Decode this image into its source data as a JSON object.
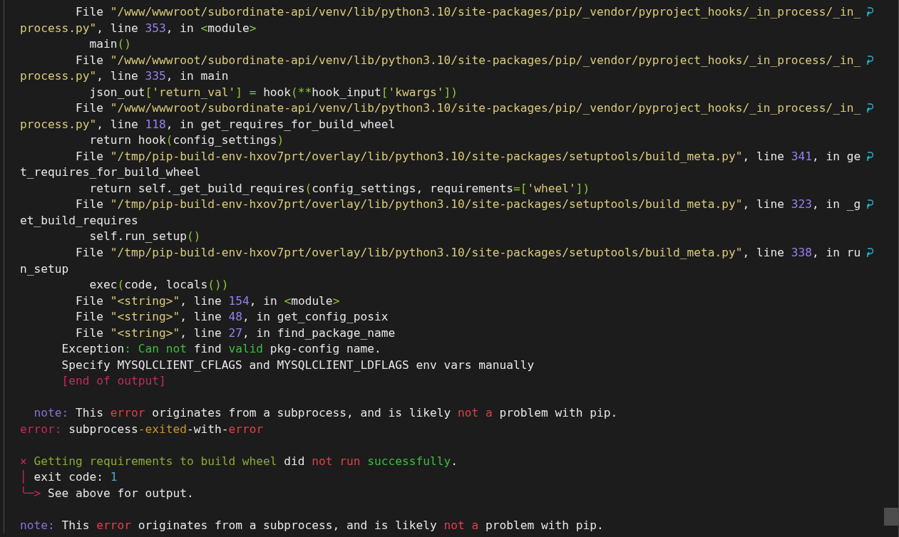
{
  "terminal": {
    "lines": [
      {
        "wrapped": true,
        "segments": [
          {
            "text": "        File ",
            "color": "#e6e6e6"
          },
          {
            "text": "\"/www/wwwroot/subordinate-api/venv/lib/python3.10/site-packages/pip/_vendor/pyproject_hooks/_in_process/_in_",
            "color": "#d9cb78"
          }
        ]
      },
      {
        "wrapped": false,
        "segments": [
          {
            "text": "process.py\"",
            "color": "#d9cb78"
          },
          {
            "text": ", line ",
            "color": "#e6e6e6"
          },
          {
            "text": "353",
            "color": "#9b7ff0"
          },
          {
            "text": ", in ",
            "color": "#e6e6e6"
          },
          {
            "text": "<",
            "color": "#8cc83c"
          },
          {
            "text": "module",
            "color": "#e6e6e6"
          },
          {
            "text": ">",
            "color": "#8cc83c"
          }
        ]
      },
      {
        "wrapped": false,
        "segments": [
          {
            "text": "          main",
            "color": "#e6e6e6"
          },
          {
            "text": "()",
            "color": "#8cc83c"
          }
        ]
      },
      {
        "wrapped": true,
        "segments": [
          {
            "text": "        File ",
            "color": "#e6e6e6"
          },
          {
            "text": "\"/www/wwwroot/subordinate-api/venv/lib/python3.10/site-packages/pip/_vendor/pyproject_hooks/_in_process/_in_",
            "color": "#d9cb78"
          }
        ]
      },
      {
        "wrapped": false,
        "segments": [
          {
            "text": "process.py\"",
            "color": "#d9cb78"
          },
          {
            "text": ", line ",
            "color": "#e6e6e6"
          },
          {
            "text": "335",
            "color": "#9b7ff0"
          },
          {
            "text": ", in main",
            "color": "#e6e6e6"
          }
        ]
      },
      {
        "wrapped": false,
        "segments": [
          {
            "text": "          json_out",
            "color": "#e6e6e6"
          },
          {
            "text": "[",
            "color": "#8cc83c"
          },
          {
            "text": "'return_val'",
            "color": "#d9cb78"
          },
          {
            "text": "] = ",
            "color": "#8cc83c"
          },
          {
            "text": "hook",
            "color": "#e6e6e6"
          },
          {
            "text": "(**",
            "color": "#8cc83c"
          },
          {
            "text": "hook_input",
            "color": "#e6e6e6"
          },
          {
            "text": "[",
            "color": "#8cc83c"
          },
          {
            "text": "'kwargs'",
            "color": "#d9cb78"
          },
          {
            "text": "])",
            "color": "#8cc83c"
          }
        ]
      },
      {
        "wrapped": true,
        "segments": [
          {
            "text": "        File ",
            "color": "#e6e6e6"
          },
          {
            "text": "\"/www/wwwroot/subordinate-api/venv/lib/python3.10/site-packages/pip/_vendor/pyproject_hooks/_in_process/_in_",
            "color": "#d9cb78"
          }
        ]
      },
      {
        "wrapped": false,
        "segments": [
          {
            "text": "process.py\"",
            "color": "#d9cb78"
          },
          {
            "text": ", line ",
            "color": "#e6e6e6"
          },
          {
            "text": "118",
            "color": "#9b7ff0"
          },
          {
            "text": ", in get_requires_for_build_wheel",
            "color": "#e6e6e6"
          }
        ]
      },
      {
        "wrapped": false,
        "segments": [
          {
            "text": "          return hook",
            "color": "#e6e6e6"
          },
          {
            "text": "(",
            "color": "#8cc83c"
          },
          {
            "text": "config_settings",
            "color": "#e6e6e6"
          },
          {
            "text": ")",
            "color": "#8cc83c"
          }
        ]
      },
      {
        "wrapped": true,
        "segments": [
          {
            "text": "        File ",
            "color": "#e6e6e6"
          },
          {
            "text": "\"/tmp/pip-build-env-hxov7prt/overlay/lib/python3.10/site-packages/setuptools/build_meta.py\"",
            "color": "#d9cb78"
          },
          {
            "text": ", line ",
            "color": "#e6e6e6"
          },
          {
            "text": "341",
            "color": "#9b7ff0"
          },
          {
            "text": ", in ge",
            "color": "#e6e6e6"
          }
        ]
      },
      {
        "wrapped": false,
        "segments": [
          {
            "text": "t_requires_for_build_wheel",
            "color": "#e6e6e6"
          }
        ]
      },
      {
        "wrapped": false,
        "segments": [
          {
            "text": "          return self._get_build_requires",
            "color": "#e6e6e6"
          },
          {
            "text": "(",
            "color": "#8cc83c"
          },
          {
            "text": "config_settings, requirements",
            "color": "#e6e6e6"
          },
          {
            "text": "=[",
            "color": "#8cc83c"
          },
          {
            "text": "'wheel'",
            "color": "#d9cb78"
          },
          {
            "text": "])",
            "color": "#8cc83c"
          }
        ]
      },
      {
        "wrapped": true,
        "segments": [
          {
            "text": "        File ",
            "color": "#e6e6e6"
          },
          {
            "text": "\"/tmp/pip-build-env-hxov7prt/overlay/lib/python3.10/site-packages/setuptools/build_meta.py\"",
            "color": "#d9cb78"
          },
          {
            "text": ", line ",
            "color": "#e6e6e6"
          },
          {
            "text": "323",
            "color": "#9b7ff0"
          },
          {
            "text": ", in _g",
            "color": "#e6e6e6"
          }
        ]
      },
      {
        "wrapped": false,
        "segments": [
          {
            "text": "et_build_requires",
            "color": "#e6e6e6"
          }
        ]
      },
      {
        "wrapped": false,
        "segments": [
          {
            "text": "          self.run_setup",
            "color": "#e6e6e6"
          },
          {
            "text": "()",
            "color": "#8cc83c"
          }
        ]
      },
      {
        "wrapped": true,
        "segments": [
          {
            "text": "        File ",
            "color": "#e6e6e6"
          },
          {
            "text": "\"/tmp/pip-build-env-hxov7prt/overlay/lib/python3.10/site-packages/setuptools/build_meta.py\"",
            "color": "#d9cb78"
          },
          {
            "text": ", line ",
            "color": "#e6e6e6"
          },
          {
            "text": "338",
            "color": "#9b7ff0"
          },
          {
            "text": ", in ru",
            "color": "#e6e6e6"
          }
        ]
      },
      {
        "wrapped": false,
        "segments": [
          {
            "text": "n_setup",
            "color": "#e6e6e6"
          }
        ]
      },
      {
        "wrapped": false,
        "segments": [
          {
            "text": "          exec",
            "color": "#e6e6e6"
          },
          {
            "text": "(",
            "color": "#8cc83c"
          },
          {
            "text": "code, locals",
            "color": "#e6e6e6"
          },
          {
            "text": "())",
            "color": "#8cc83c"
          }
        ]
      },
      {
        "wrapped": false,
        "segments": [
          {
            "text": "        File ",
            "color": "#e6e6e6"
          },
          {
            "text": "\"<string>\"",
            "color": "#d9cb78"
          },
          {
            "text": ", line ",
            "color": "#e6e6e6"
          },
          {
            "text": "154",
            "color": "#9b7ff0"
          },
          {
            "text": ", in ",
            "color": "#e6e6e6"
          },
          {
            "text": "<",
            "color": "#8cc83c"
          },
          {
            "text": "module",
            "color": "#e6e6e6"
          },
          {
            "text": ">",
            "color": "#8cc83c"
          }
        ]
      },
      {
        "wrapped": false,
        "segments": [
          {
            "text": "        File ",
            "color": "#e6e6e6"
          },
          {
            "text": "\"<string>\"",
            "color": "#d9cb78"
          },
          {
            "text": ", line ",
            "color": "#e6e6e6"
          },
          {
            "text": "48",
            "color": "#9b7ff0"
          },
          {
            "text": ", in get_config_posix",
            "color": "#e6e6e6"
          }
        ]
      },
      {
        "wrapped": false,
        "segments": [
          {
            "text": "        File ",
            "color": "#e6e6e6"
          },
          {
            "text": "\"<string>\"",
            "color": "#d9cb78"
          },
          {
            "text": ", line ",
            "color": "#e6e6e6"
          },
          {
            "text": "27",
            "color": "#9b7ff0"
          },
          {
            "text": ", in find_package_name",
            "color": "#e6e6e6"
          }
        ]
      },
      {
        "wrapped": false,
        "segments": [
          {
            "text": "      Exception",
            "color": "#e6e6e6"
          },
          {
            "text": ": Can not",
            "color": "#3cbe3c"
          },
          {
            "text": " find ",
            "color": "#e6e6e6"
          },
          {
            "text": "valid",
            "color": "#3cbe3c"
          },
          {
            "text": " pkg-config name.",
            "color": "#e6e6e6"
          }
        ]
      },
      {
        "wrapped": false,
        "segments": [
          {
            "text": "      Specify MYSQLCLIENT_CFLAGS and MYSQLCLIENT_LDFLAGS env vars manually",
            "color": "#e6e6e6"
          }
        ]
      },
      {
        "wrapped": false,
        "segments": [
          {
            "text": "      [end of output]",
            "color": "#c82a5c"
          }
        ]
      },
      {
        "wrapped": false
      },
      {
        "wrapped": false,
        "segments": [
          {
            "text": "  note:",
            "color": "#8a70d8"
          },
          {
            "text": " This ",
            "color": "#e6e6e6"
          },
          {
            "text": "error",
            "color": "#e0404a"
          },
          {
            "text": " originates from a subprocess, and is likely ",
            "color": "#e6e6e6"
          },
          {
            "text": "not a",
            "color": "#e0404a"
          },
          {
            "text": " problem with pip.",
            "color": "#e6e6e6"
          }
        ]
      },
      {
        "wrapped": false,
        "segments": [
          {
            "text": "error:",
            "color": "#c8285a"
          },
          {
            "text": " subprocess",
            "color": "#e6e6e6"
          },
          {
            "text": "-exited",
            "color": "#c8962a"
          },
          {
            "text": "-with-",
            "color": "#e6e6e6"
          },
          {
            "text": "error",
            "color": "#e0404a"
          }
        ]
      },
      {
        "wrapped": false
      },
      {
        "wrapped": false,
        "segments": [
          {
            "text": "×",
            "color": "#c8285a"
          },
          {
            "text": " Getting requirements to build wheel",
            "color": "#8aaa30"
          },
          {
            "text": " did ",
            "color": "#e6e6e6"
          },
          {
            "text": "not run",
            "color": "#e0404a"
          },
          {
            "text": " successfully",
            "color": "#3cbe3c"
          },
          {
            "text": "."
          }
        ]
      },
      {
        "wrapped": false,
        "segments": [
          {
            "text": "│",
            "color": "#c8285a"
          },
          {
            "text": " exit code: ",
            "color": "#e6e6e6"
          },
          {
            "text": "1",
            "color": "#4aaac8"
          }
        ]
      },
      {
        "wrapped": false,
        "segments": [
          {
            "text": "╰─>",
            "color": "#c8285a"
          },
          {
            "text": " See above for output.",
            "color": "#e6e6e6"
          }
        ]
      },
      {
        "wrapped": false
      },
      {
        "wrapped": false,
        "segments": [
          {
            "text": "note:",
            "color": "#8a70d8"
          },
          {
            "text": " This ",
            "color": "#e6e6e6"
          },
          {
            "text": "error",
            "color": "#e0404a"
          },
          {
            "text": " originates from a subprocess, and is likely ",
            "color": "#e6e6e6"
          },
          {
            "text": "not a",
            "color": "#e0404a"
          },
          {
            "text": " problem with pip.",
            "color": "#e6e6e6"
          }
        ]
      }
    ]
  }
}
